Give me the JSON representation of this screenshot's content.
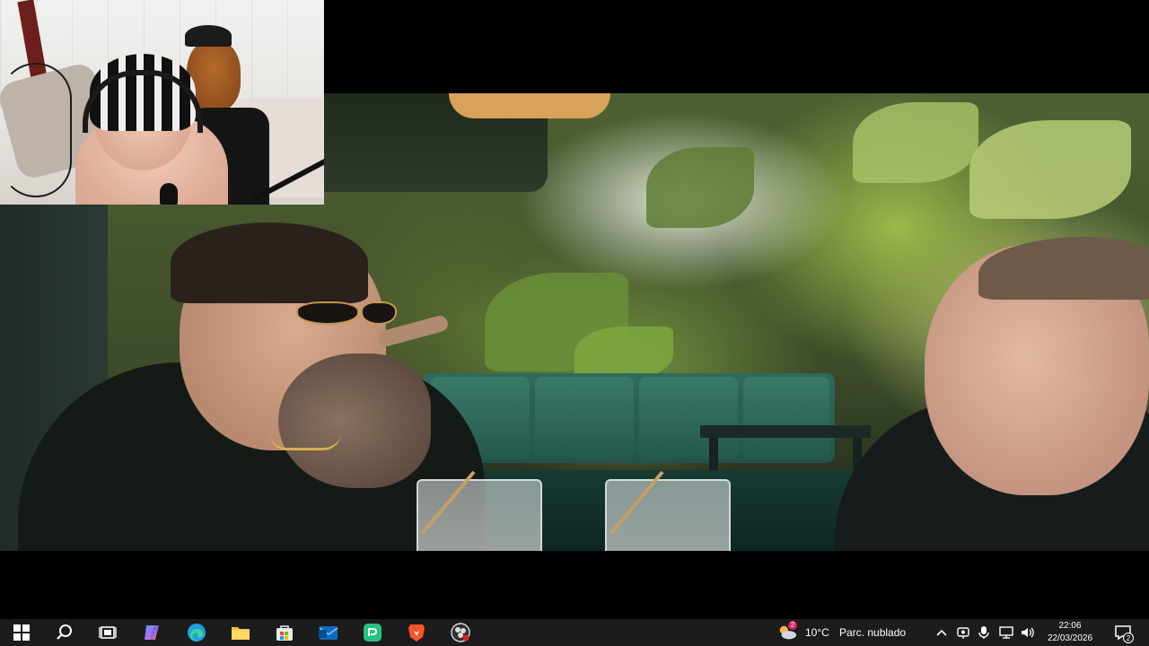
{
  "taskbar": {
    "pinned_apps": [
      {
        "name": "start",
        "icon": "windows-logo-icon"
      },
      {
        "name": "search",
        "icon": "search-icon"
      },
      {
        "name": "task-view",
        "icon": "task-view-icon"
      },
      {
        "name": "copilot",
        "icon": "copilot-icon"
      },
      {
        "name": "edge",
        "icon": "edge-icon"
      },
      {
        "name": "file-explorer",
        "icon": "folder-icon"
      },
      {
        "name": "microsoft-store",
        "icon": "store-icon"
      },
      {
        "name": "outlook",
        "icon": "mail-icon"
      },
      {
        "name": "green-app",
        "icon": "green-app-icon"
      },
      {
        "name": "brave",
        "icon": "brave-lion-icon"
      },
      {
        "name": "obs",
        "icon": "obs-icon"
      }
    ],
    "weather": {
      "temperature": "10°C",
      "condition": "Parc. nublado",
      "icon": "weather-cloud-sun-icon",
      "badge": "2"
    },
    "clock": {
      "time": "22:06",
      "date": "22/03/2026"
    },
    "notifications": {
      "count": "2"
    },
    "colors": {
      "background": "#1c1c1c",
      "text": "#ffffff",
      "accent": "#0078d4"
    }
  }
}
